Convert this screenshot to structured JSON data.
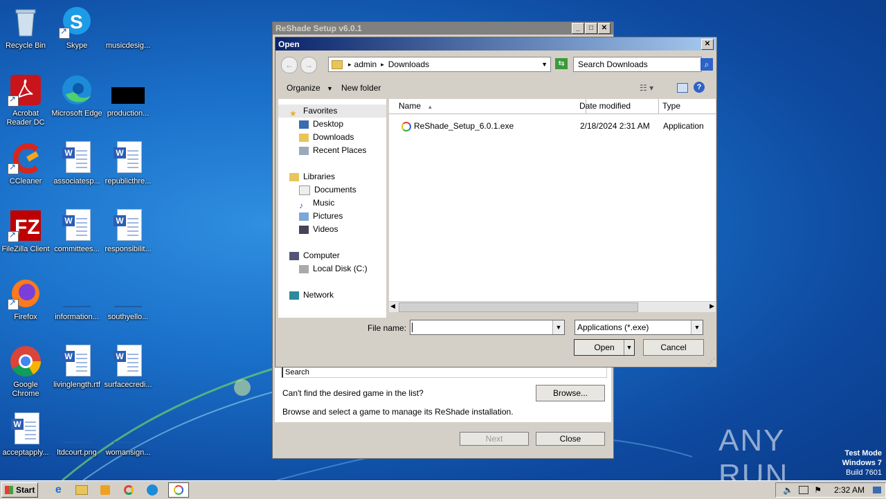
{
  "desktop": {
    "icons": [
      {
        "label": "Recycle Bin"
      },
      {
        "label": "Skype"
      },
      {
        "label": "musicdesig..."
      },
      {
        "label": "Acrobat Reader DC"
      },
      {
        "label": "Microsoft Edge"
      },
      {
        "label": "production..."
      },
      {
        "label": "CCleaner"
      },
      {
        "label": "associatesp..."
      },
      {
        "label": "republicthre..."
      },
      {
        "label": "FileZilla Client"
      },
      {
        "label": "committees..."
      },
      {
        "label": "responsibilit..."
      },
      {
        "label": "Firefox"
      },
      {
        "label": "information..."
      },
      {
        "label": "southyello..."
      },
      {
        "label": "Google Chrome"
      },
      {
        "label": "livinglength.rtf"
      },
      {
        "label": "surfacecredi..."
      },
      {
        "label": "acceptapply..."
      },
      {
        "label": "ltdcourt.png"
      },
      {
        "label": "womansign..."
      }
    ]
  },
  "reshade": {
    "title": "ReShade Setup v6.0.1",
    "search_value": "Search",
    "cant_find": "Can't find the desired game in the list?",
    "browse_label": "Browse...",
    "browse_desc": "Browse and select a game to manage its ReShade installation.",
    "next_label": "Next",
    "close_label": "Close"
  },
  "open_dialog": {
    "title": "Open",
    "breadcrumb": [
      "admin",
      "Downloads"
    ],
    "search_placeholder": "Search Downloads",
    "organize_label": "Organize",
    "new_folder_label": "New folder",
    "nav": {
      "favorites": "Favorites",
      "desktop": "Desktop",
      "downloads": "Downloads",
      "recent": "Recent Places",
      "libraries": "Libraries",
      "documents": "Documents",
      "music": "Music",
      "pictures": "Pictures",
      "videos": "Videos",
      "computer": "Computer",
      "local_disk": "Local Disk (C:)",
      "network": "Network"
    },
    "columns": {
      "name": "Name",
      "date": "Date modified",
      "type": "Type"
    },
    "files": [
      {
        "name": "ReShade_Setup_6.0.1.exe",
        "date": "2/18/2024 2:31 AM",
        "type": "Application"
      }
    ],
    "file_name_label": "File name:",
    "file_name_value": "",
    "filter_value": "Applications (*.exe)",
    "open_label": "Open",
    "cancel_label": "Cancel"
  },
  "taskbar": {
    "start_label": "Start",
    "clock": "2:32 AM"
  },
  "watermark": {
    "brand": "ANY RUN",
    "line1": "Test Mode",
    "line2": "Windows 7",
    "line3": "Build 7601"
  }
}
